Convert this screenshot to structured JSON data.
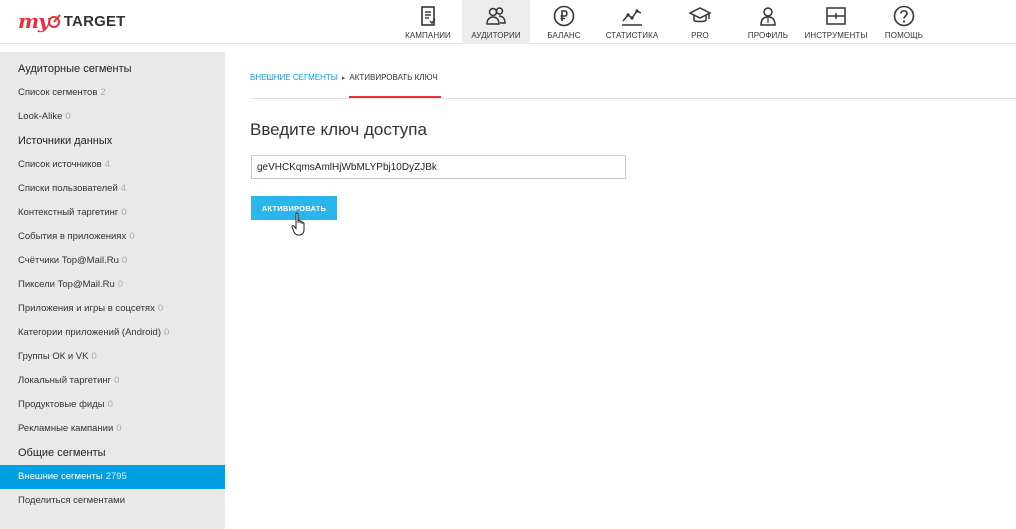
{
  "logo": {
    "my": "my",
    "target": "TARGET"
  },
  "nav": [
    {
      "label": "КАМПАНИИ",
      "icon": "document-icon",
      "active": false
    },
    {
      "label": "АУДИТОРИИ",
      "icon": "users-icon",
      "active": true
    },
    {
      "label": "БАЛАНС",
      "icon": "ruble-icon",
      "active": false
    },
    {
      "label": "СТАТИСТИКА",
      "icon": "chart-line-icon",
      "active": false
    },
    {
      "label": "PRO",
      "icon": "graduation-cap-icon",
      "active": false
    },
    {
      "label": "ПРОФИЛЬ",
      "icon": "profile-icon",
      "active": false
    },
    {
      "label": "ИНСТРУМЕНТЫ",
      "icon": "tools-icon",
      "active": false
    },
    {
      "label": "ПОМОЩЬ",
      "icon": "help-icon",
      "active": false
    }
  ],
  "sidebar": {
    "sections": [
      {
        "heading": "Аудиторные сегменты",
        "items": [
          {
            "label": "Список сегментов",
            "count": "2"
          },
          {
            "label": "Look-Alike",
            "count": "0"
          }
        ]
      },
      {
        "heading": "Источники данных",
        "items": [
          {
            "label": "Список источников",
            "count": "4"
          },
          {
            "label": "Списки пользователей",
            "count": "4"
          },
          {
            "label": "Контекстный таргетинг",
            "count": "0"
          },
          {
            "label": "События в приложениях",
            "count": "0"
          },
          {
            "label": "Счётчики Top@Mail.Ru",
            "count": "0"
          },
          {
            "label": "Пиксели Top@Mail.Ru",
            "count": "0"
          },
          {
            "label": "Приложения и игры в соцсетях",
            "count": "0"
          },
          {
            "label": "Категории приложений (Android)",
            "count": "0"
          },
          {
            "label": "Группы ОК и VK",
            "count": "0"
          },
          {
            "label": "Локальный таргетинг",
            "count": "0"
          },
          {
            "label": "Продуктовые фиды",
            "count": "0"
          },
          {
            "label": "Рекламные кампании",
            "count": "0"
          }
        ]
      },
      {
        "heading": "Общие сегменты",
        "items": [
          {
            "label": "Внешние сегменты",
            "count": "2795",
            "active": true
          },
          {
            "label": "Поделиться сегментами",
            "count": ""
          }
        ]
      }
    ]
  },
  "breadcrumb": {
    "parent": "ВНЕШНИЕ СЕГМЕНТЫ",
    "separator": "▸",
    "current": "АКТИВИРОВАТЬ КЛЮЧ"
  },
  "main": {
    "title": "Введите ключ доступа",
    "key_value": "geVHCKqmsAmlHjWbMLYPbj10DyZJBk",
    "activate_label": "АКТИВИРОВАТЬ"
  },
  "colors": {
    "accent": "#00a0e3",
    "button": "#29b6ed",
    "brand_red": "#e8303a",
    "sidebar_bg": "#e9e9e9"
  }
}
